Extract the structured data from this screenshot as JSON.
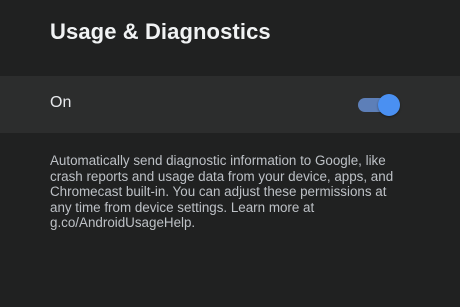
{
  "header": {
    "title": "Usage & Diagnostics"
  },
  "setting": {
    "label": "On",
    "toggle_state": "on",
    "toggle_color": "#4a90f2"
  },
  "description": {
    "text": "Automatically send diagnostic information to Google, like crash reports and usage data from your device, apps, and Chromecast built-in. You can adjust these permissions at any time from device settings. Learn more at g.co/AndroidUsageHelp."
  }
}
